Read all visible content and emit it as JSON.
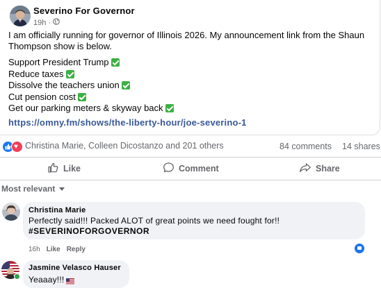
{
  "post": {
    "author": "Severino For Governor",
    "time": "19h",
    "separator": "·",
    "audience_icon": "globe-icon",
    "text": "I am officially running for governor of Illinois 2026. My announcement link from the Shaun Thompson show is below.",
    "points": [
      "Support President Trump",
      "Reduce taxes",
      "Dissolve the teachers union",
      "Cut pension cost",
      "Get our parking meters & skyway back"
    ],
    "point_icon": "check-mark-icon",
    "link": "https://omny.fm/shows/the-liberty-hour/joe-severino-1"
  },
  "reactions": {
    "icons": [
      "like-icon",
      "love-icon"
    ],
    "summary": "Christina Marie, Colleen Dicostanzo and 201 others",
    "comments": "84 comments",
    "shares": "14 shares"
  },
  "actions": {
    "like": "Like",
    "comment": "Comment",
    "share": "Share"
  },
  "comments_section": {
    "sort_label": "Most relevant",
    "comments": [
      {
        "author": "Christina Marie",
        "line1": "Perfectly said!!! Packed ALOT of great points we need fought for!!",
        "line2": "#SEVERINOFORGOVERNOR",
        "time": "16h",
        "like": "Like",
        "reply": "Reply",
        "reaction": "like"
      },
      {
        "author": "Jasmine Velasco Hauser",
        "text": "Yeaaay!!!",
        "emoji": "us-flag-icon"
      }
    ]
  },
  "colors": {
    "link": "#385898",
    "muted": "#65676b",
    "bubble": "#f0f2f5",
    "like_blue": "#1877f2",
    "love_red": "#f33e58",
    "check_green": "#3cb043"
  }
}
